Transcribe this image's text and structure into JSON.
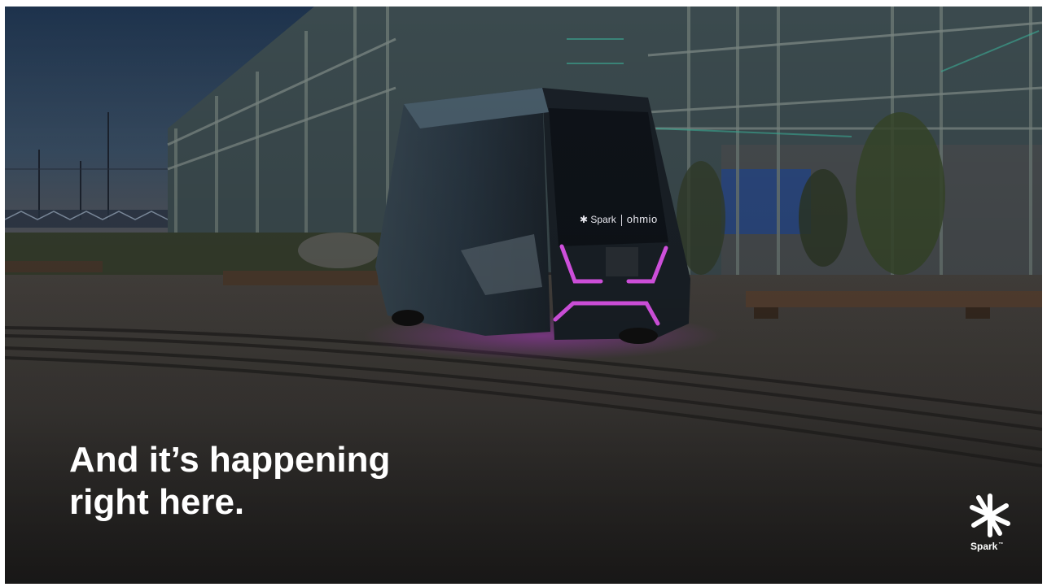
{
  "slide": {
    "headline_line1": "And it’s happening",
    "headline_line2": "right here.",
    "logo": {
      "name": "spark-logo",
      "word": "Spark",
      "mark": "™"
    },
    "vehicle": {
      "brand_primary": "Spark",
      "brand_secondary": "ohmio"
    },
    "colors": {
      "neon": "#e040ff",
      "headline": "#ffffff",
      "sky": "#23384f"
    }
  }
}
